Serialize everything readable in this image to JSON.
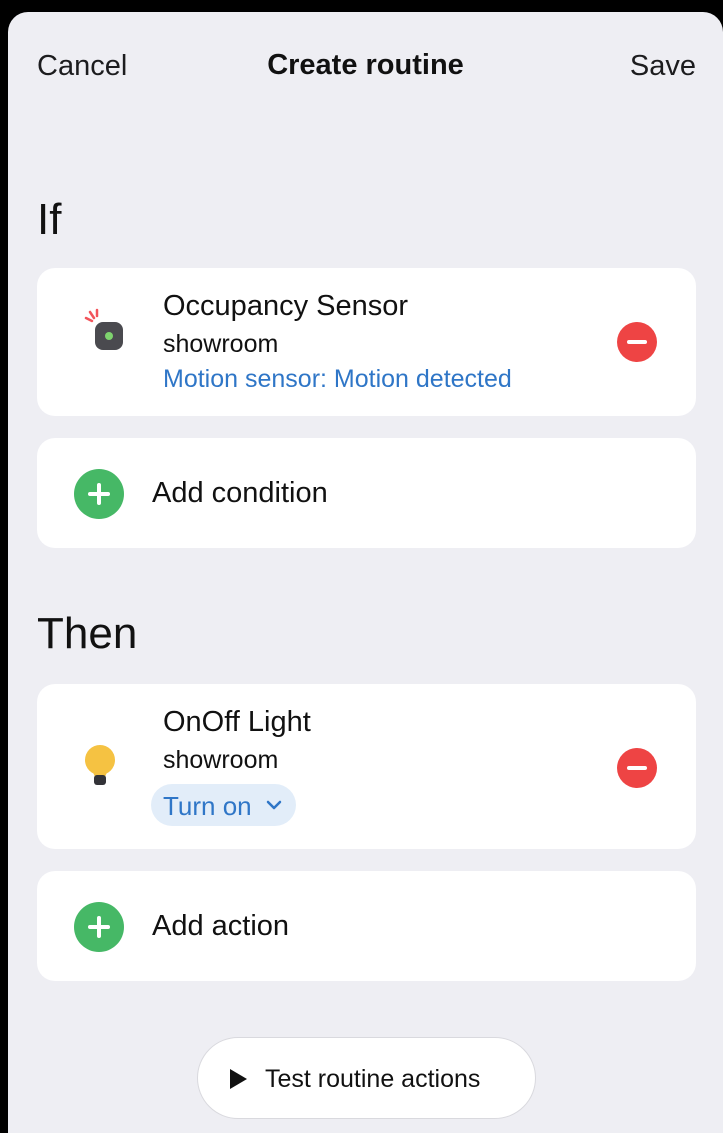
{
  "header": {
    "cancel_label": "Cancel",
    "title": "Create routine",
    "save_label": "Save"
  },
  "if_section": {
    "title": "If",
    "condition": {
      "icon": "occupancy-sensor-icon",
      "name": "Occupancy Sensor",
      "room": "showroom",
      "state": "Motion sensor: Motion detected"
    },
    "add_label": "Add condition"
  },
  "then_section": {
    "title": "Then",
    "action": {
      "icon": "light-bulb-icon",
      "name": "OnOff Light",
      "room": "showroom",
      "selected_action": "Turn on"
    },
    "add_label": "Add action"
  },
  "test_button": {
    "label": "Test routine actions"
  },
  "colors": {
    "background": "#EEEEF3",
    "card": "#FFFFFF",
    "accent_blue": "#2F76C7",
    "add_green": "#46B866",
    "remove_red": "#EE4444",
    "bulb_yellow": "#F5C242"
  }
}
